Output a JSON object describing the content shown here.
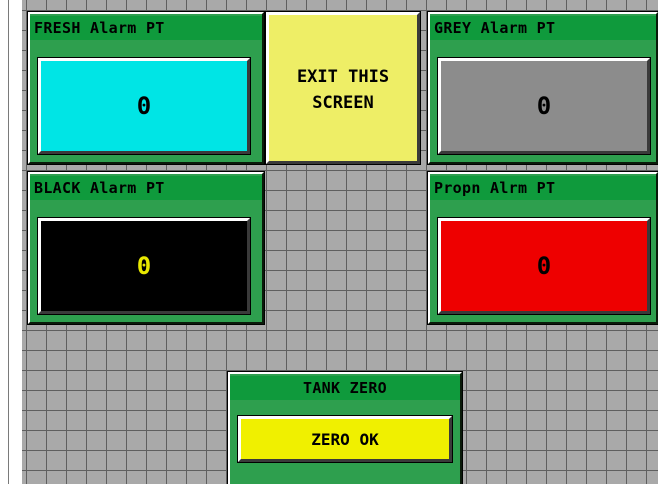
{
  "panels": {
    "fresh": {
      "title": "FRESH Alarm PT",
      "value": "0",
      "color": "#00e5e5",
      "text_color": "#000000"
    },
    "grey": {
      "title": "GREY Alarm PT",
      "value": "0",
      "color": "#8c8c8c",
      "text_color": "#000000"
    },
    "black": {
      "title": "BLACK Alarm PT",
      "value": "0",
      "color": "#000000",
      "text_color": "#e8e800"
    },
    "propn": {
      "title": "Propn Alrm PT",
      "value": "0",
      "color": "#ee0000",
      "text_color": "#000000"
    }
  },
  "exit_button": {
    "line1": "EXIT THIS",
    "line2": "SCREEN",
    "color": "#eeee66"
  },
  "tank_zero": {
    "title": "TANK ZERO",
    "button_label": "ZERO OK",
    "button_color": "#f0f000"
  },
  "colors": {
    "panel_green": "#0f9a3c",
    "grid": "#a9a9a9"
  }
}
